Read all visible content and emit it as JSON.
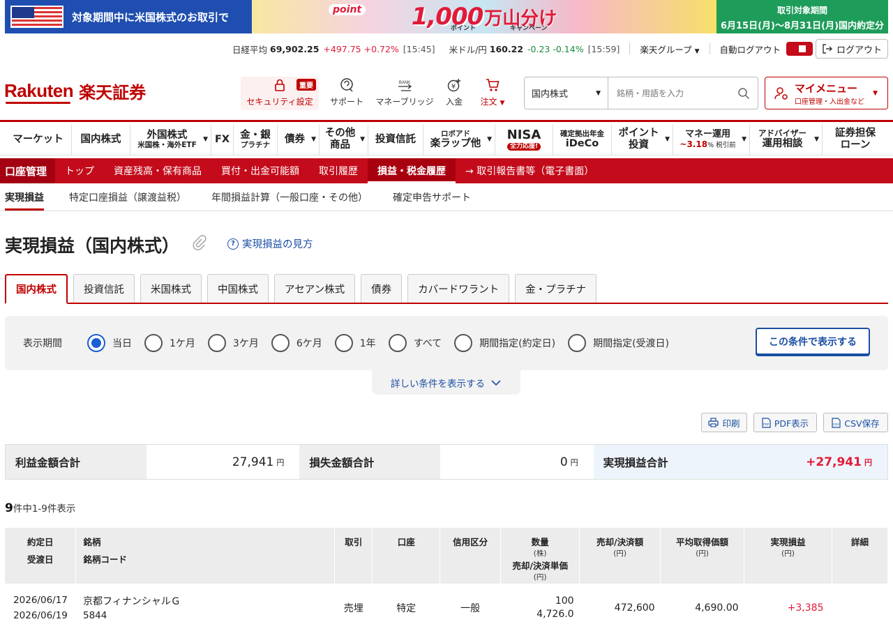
{
  "banner": {
    "left_text": "対象期間中に米国株式のお取引で",
    "point_tag": "point",
    "amount": "1,000",
    "campaign_title": "万山分け",
    "sub1": "ポイント",
    "sub2": "キャンペーン",
    "right_line1": "取引対象期間",
    "right_line2": "6月15日(月)〜8月31日(月)国内約定分",
    "colors": {
      "left": "#1f4eb0",
      "right": "#1e9c5a",
      "accent": "#e01b3a"
    }
  },
  "market": {
    "nikkei_label": "日経平均",
    "nikkei_value": "69,902.25",
    "nikkei_change": "+497.75 +0.72%",
    "nikkei_time": "[15:45]",
    "usd_label": "米ドル/円",
    "usd_value": "160.22",
    "usd_change": "-0.23 -0.14%",
    "usd_time": "[15:59]",
    "group_label": "楽天グループ",
    "auto_logout_label": "自動ログアウト",
    "logout_label": "ログアウト"
  },
  "header": {
    "logo_en": "Rakuten",
    "logo_jp": "楽天証券",
    "security_badge": "重要",
    "security_label": "セキュリティ設定",
    "support_label": "サポート",
    "money_bridge_label": "マネーブリッジ",
    "deposit_label": "入金",
    "order_label": "注文",
    "search_select": "国内株式",
    "search_placeholder": "銘柄・用語を入力",
    "mymenu_title": "マイメニュー",
    "mymenu_sub": "口座管理・入出金など"
  },
  "gnav": {
    "market": "マーケット",
    "domestic": "国内株式",
    "foreign": "外国株式",
    "foreign_sub": "米国株・海外ETF",
    "fx": "FX",
    "gold": "金・銀",
    "gold_sub": "プラチナ",
    "bonds": "債券",
    "other1": "その他",
    "other2": "商品",
    "fund": "投資信託",
    "robo_sub": "ロボアド",
    "robo": "楽ラップ他",
    "nisa": "NISA",
    "nisa_badge": "全力応援!",
    "ideco_sub": "確定拠出年金",
    "ideco": "iDeCo",
    "point1": "ポイント",
    "point2": "投資",
    "money1": "マネー運用",
    "money_rate": "~3.18",
    "money_rate_unit": "% 税引前",
    "advisor1": "アドバイザー",
    "advisor2": "運用相談",
    "secloan1": "証券担保",
    "secloan2": "ローン"
  },
  "account": {
    "title": "口座管理",
    "items": [
      "トップ",
      "資産残高・保有商品",
      "買付・出金可能額",
      "取引履歴",
      "損益・税金履歴",
      "→ 取引報告書等（電子書面）"
    ]
  },
  "subtabs": [
    "実現損益",
    "特定口座損益（譲渡益税）",
    "年間損益計算（一般口座・その他）",
    "確定申告サポート"
  ],
  "page": {
    "title": "実現損益（国内株式）",
    "help_link": "実現損益の見方"
  },
  "product_tabs": [
    "国内株式",
    "投資信託",
    "米国株式",
    "中国株式",
    "アセアン株式",
    "債券",
    "カバードワラント",
    "金・プラチナ"
  ],
  "period": {
    "label": "表示期間",
    "options": [
      "当日",
      "1ケ月",
      "3ケ月",
      "6ケ月",
      "1年",
      "すべて",
      "期間指定(約定日)",
      "期間指定(受渡日)"
    ],
    "selected": "当日",
    "submit_label": "この条件で表示する",
    "detail_link": "詳しい条件を表示する"
  },
  "tools": {
    "print": "印刷",
    "pdf": "PDF表示",
    "csv": "CSV保存"
  },
  "summary": {
    "profit_label": "利益金額合計",
    "profit_value": "27,941",
    "loss_label": "損失金額合計",
    "loss_value": "0",
    "realized_label": "実現損益合計",
    "realized_value": "+27,941",
    "unit": "円"
  },
  "count": {
    "total": "9",
    "text": "件中1-9件表示"
  },
  "table": {
    "headers": {
      "date1": "約定日",
      "date2": "受渡日",
      "name1": "銘柄",
      "name2": "銘柄コード",
      "trade": "取引",
      "account": "口座",
      "margin": "信用区分",
      "qty1": "数量",
      "qty_unit": "(株)",
      "qty2": "売却/決済単価",
      "qty2_unit": "(円)",
      "sell": "売却/決済額",
      "sell_unit": "(円)",
      "avg": "平均取得価額",
      "avg_unit": "(円)",
      "pl": "実現損益",
      "pl_unit": "(円)",
      "detail": "詳細"
    },
    "rows": [
      {
        "trade_date": "2026/06/17",
        "settle_date": "2026/06/19",
        "name": "京都フィナンシャルＧ",
        "code": "5844",
        "trade": "売埋",
        "account": "特定",
        "margin": "一般",
        "qty": "100",
        "price": "4,726.0",
        "amount": "472,600",
        "avg": "4,690.00",
        "pl": "+3,385"
      }
    ]
  }
}
